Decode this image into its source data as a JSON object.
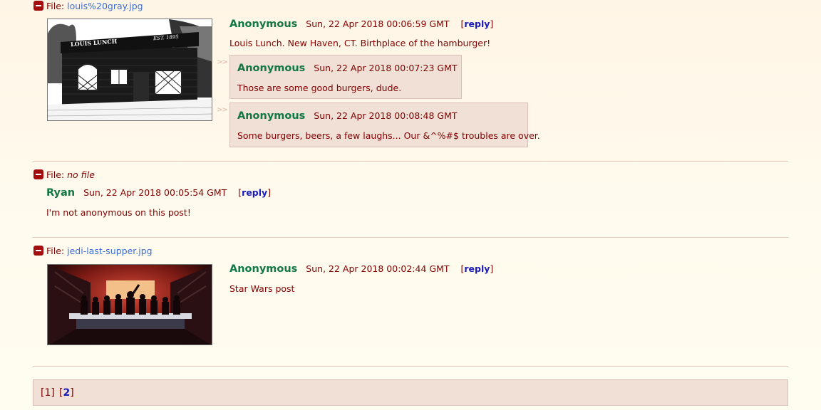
{
  "posts": [
    {
      "file_prefix": "File:",
      "file_name": "louis%20gray.jpg",
      "thumb_sign_left": "LOUIS LUNCH",
      "thumb_sign_right": "EST. 1895",
      "name": "Anonymous",
      "date": "Sun, 22 Apr 2018 00:06:59 GMT",
      "reply_open": "[",
      "reply_label": "reply",
      "reply_close": "]",
      "message": "Louis Lunch. New Haven, CT. Birthplace of the hamburger!",
      "replies": [
        {
          "arrows": ">>",
          "name": "Anonymous",
          "date": "Sun, 22 Apr 2018 00:07:23 GMT",
          "message": "Those are some good burgers, dude."
        },
        {
          "arrows": ">>",
          "name": "Anonymous",
          "date": "Sun, 22 Apr 2018 00:08:48 GMT",
          "message": "Some burgers, beers, a few laughs... Our &^%#$ troubles are over."
        }
      ]
    },
    {
      "file_prefix": "File:",
      "file_name": "no file",
      "name": "Ryan",
      "date": "Sun, 22 Apr 2018 00:05:54 GMT",
      "reply_open": "[",
      "reply_label": "reply",
      "reply_close": "]",
      "message": "I'm not anonymous on this post!"
    },
    {
      "file_prefix": "File:",
      "file_name": "jedi-last-supper.jpg",
      "name": "Anonymous",
      "date": "Sun, 22 Apr 2018 00:02:44 GMT",
      "reply_open": "[",
      "reply_label": "reply",
      "reply_close": "]",
      "message": "Star Wars post"
    }
  ],
  "pagination": {
    "page1": "[1]",
    "page2_open": "[",
    "page2": "2",
    "page2_close": "]"
  },
  "colors": {
    "name": "#117743",
    "text": "#800000",
    "link": "#1a1ab8",
    "file_link": "#3b6dd6",
    "reply_bg": "#f0e0d6",
    "hide_button": "#a30d0d"
  }
}
